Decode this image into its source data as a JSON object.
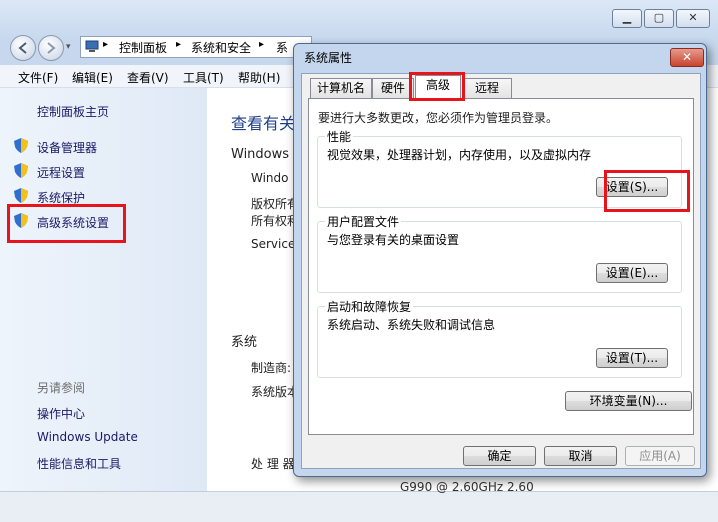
{
  "breadcrumb": {
    "items": [
      "控制面板",
      "系统和安全",
      "系"
    ]
  },
  "menubar": {
    "items": [
      "文件(F)",
      "编辑(E)",
      "查看(V)",
      "工具(T)",
      "帮助(H)"
    ]
  },
  "left_pane": {
    "home_link": "控制面板主页",
    "links": [
      "设备管理器",
      "远程设置",
      "系统保护",
      "高级系统设置"
    ],
    "see_also_label": "另请参阅",
    "see_also": [
      "操作中心",
      "Windows Update",
      "性能信息和工具"
    ]
  },
  "right_pane": {
    "heading": "查看有关",
    "edition_label": "Windows 版",
    "edition_value": "Windo",
    "copyright_1": "版权所有",
    "copyright_2": "所有权利",
    "service": "Service",
    "system_label": "系统",
    "manufacturer": "制造商:",
    "system_version": "系统版本",
    "processor": "处 理 器",
    "processor_value": "G990 @ 2.60GHz  2.60"
  },
  "dialog": {
    "title": "系统属性",
    "close_glyph": "✕",
    "tabs": [
      "计算机名",
      "硬件",
      "高级",
      "远程"
    ],
    "active_tab_index": 2,
    "admin_note": "要进行大多数更改，您必须作为管理员登录。",
    "performance": {
      "legend": "性能",
      "desc": "视觉效果，处理器计划，内存使用，以及虚拟内存",
      "button": "设置(S)..."
    },
    "user_profiles": {
      "legend": "用户配置文件",
      "desc": "与您登录有关的桌面设置",
      "button": "设置(E)..."
    },
    "startup_recovery": {
      "legend": "启动和故障恢复",
      "desc": "系统启动、系统失败和调试信息",
      "button": "设置(T)..."
    },
    "env_button": "环境变量(N)...",
    "ok": "确定",
    "cancel": "取消",
    "apply": "应用(A)"
  },
  "colors": {
    "highlight_red": "#e8141b",
    "link_blue": "#1a1a66",
    "dialog_frame": "#c4d6ee"
  },
  "icons": [
    "back-arrow-icon",
    "forward-arrow-icon",
    "computer-icon",
    "shield-icon",
    "close-icon",
    "minimize-icon",
    "maximize-icon"
  ]
}
